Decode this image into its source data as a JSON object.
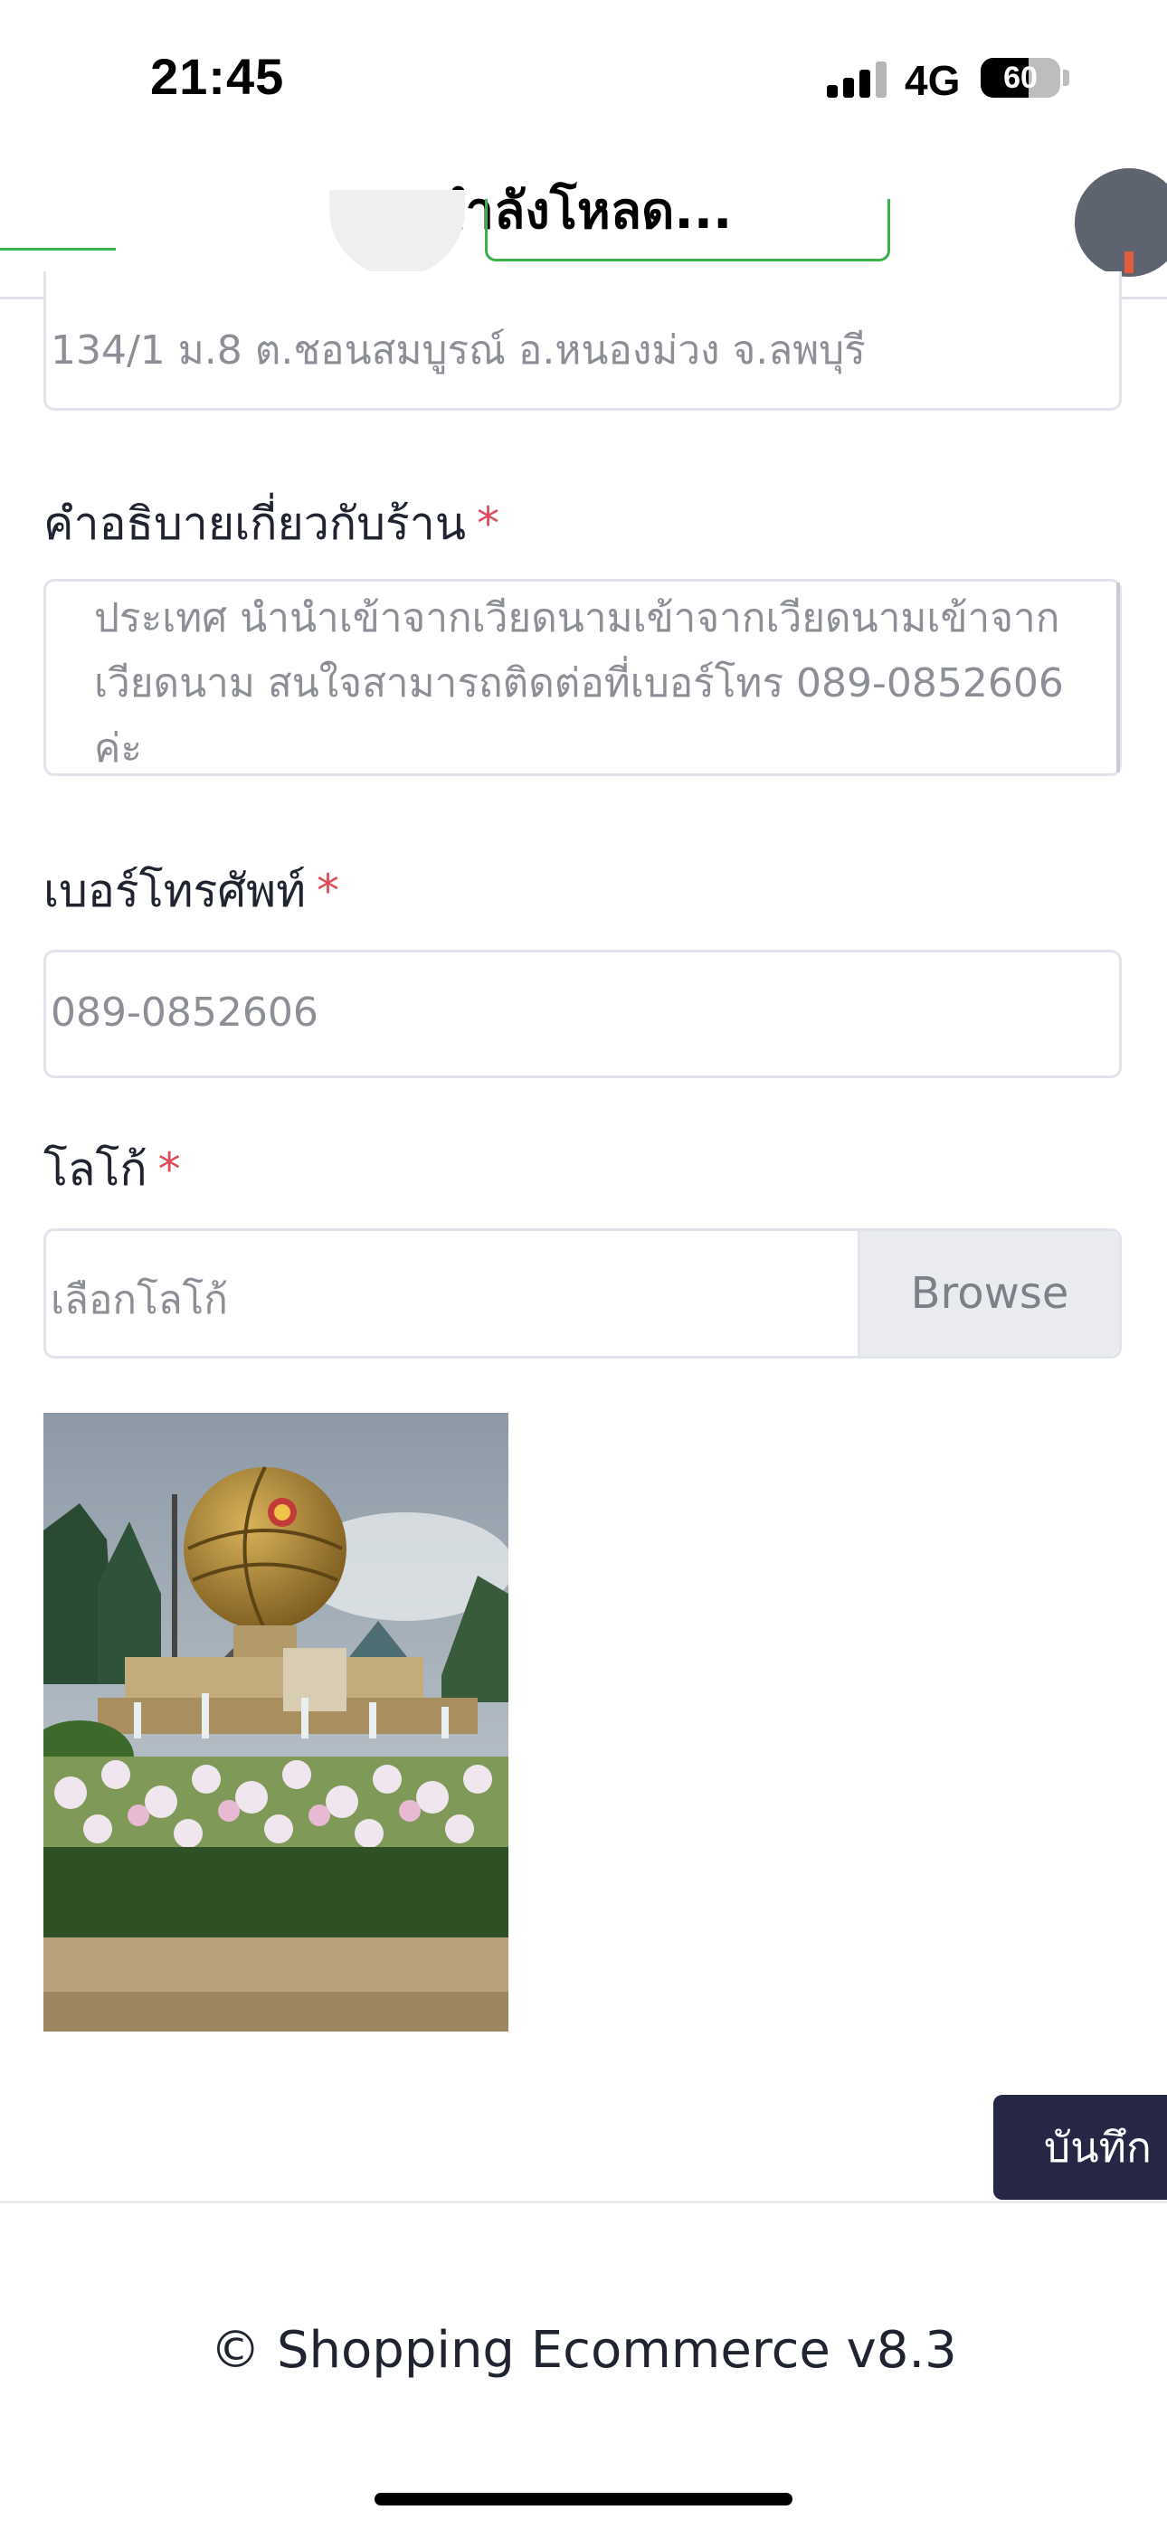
{
  "status_bar": {
    "time": "21:45",
    "network": "4G",
    "battery": "60",
    "battery_level": 0.6,
    "signal_bars": 3
  },
  "header": {
    "title": "กำลังโหลด..."
  },
  "form": {
    "address": {
      "value": "134/1 ม.8 ต.ชอนสมบูรณ์ อ.หนองม่วง จ.ลพบุรี"
    },
    "description": {
      "label": "คำอธิบายเกี่ยวกับร้าน",
      "required_mark": "*",
      "value": "ประเทศ นำนำเข้าจากเวียดนามเข้าจากเวียดนามเข้าจากเวียดนาม สนใจสามารถติดต่อที่เบอร์โทร 089-0852606 ค่ะ"
    },
    "phone": {
      "label": "เบอร์โทรศัพท์",
      "required_mark": "*",
      "value": "089-0852606"
    },
    "logo": {
      "label": "โลโก้",
      "required_mark": "*",
      "placeholder": "เลือกโลโก้",
      "browse_label": "Browse"
    },
    "save_label": "บันทึก"
  },
  "footer": {
    "text": "© Shopping Ecommerce v8.3"
  },
  "colors": {
    "accent_green": "#3bb04a",
    "save_button": "#262645",
    "required": "#e04b5a",
    "border": "#e1e4ea"
  }
}
